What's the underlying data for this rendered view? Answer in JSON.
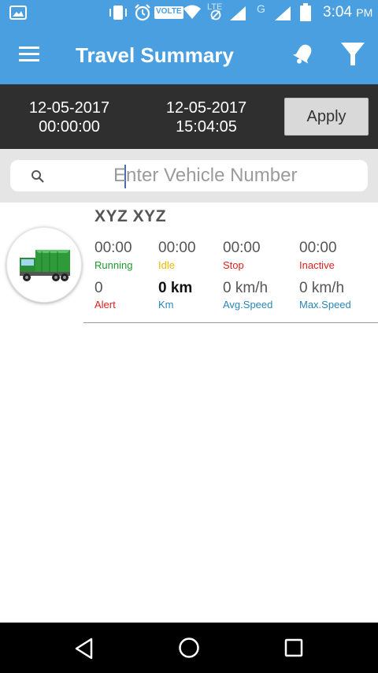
{
  "status_bar": {
    "time": "3:04",
    "ampm": "PM",
    "volte": "VOLTE",
    "lte": "LTE",
    "g": "G"
  },
  "header": {
    "title": "Travel Summary"
  },
  "date_range": {
    "from_date": "12-05-2017",
    "from_time": "00:00:00",
    "to_date": "12-05-2017",
    "to_time": "15:04:05",
    "apply_label": "Apply"
  },
  "search": {
    "placeholder": "Enter Vehicle Number",
    "value": ""
  },
  "vehicle": {
    "name": "XYZ XYZ",
    "running": {
      "value": "00:00",
      "label": "Running"
    },
    "idle": {
      "value": "00:00",
      "label": "Idle"
    },
    "stop": {
      "value": "00:00",
      "label": "Stop"
    },
    "inactive": {
      "value": "00:00",
      "label": "Inactive"
    },
    "alert": {
      "value": "0",
      "label": "Alert"
    },
    "km": {
      "value": "0 km",
      "label": "Km"
    },
    "avg_speed": {
      "value": "0 km/h",
      "label": "Avg.Speed"
    },
    "max_speed": {
      "value": "0 km/h",
      "label": "Max.Speed"
    }
  },
  "colors": {
    "primary": "#4a9fe0",
    "date_bar": "#2f2f2f",
    "running": "#1e9a2c",
    "idle": "#e8b800",
    "stop": "#e02020",
    "inactive": "#e02020",
    "alert": "#e02020",
    "info": "#2a86b8"
  }
}
